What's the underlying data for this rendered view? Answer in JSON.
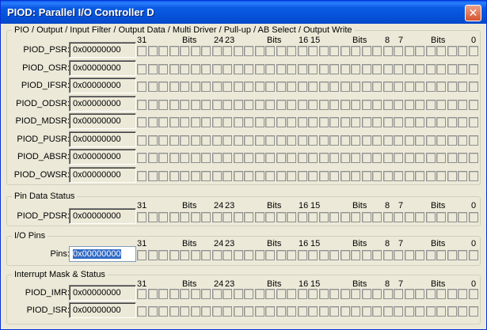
{
  "window": {
    "title": "PIOD: Parallel I/O Controller D",
    "close_glyph": "✕"
  },
  "groups": [
    {
      "title": "PIO / Output / Input Filter / Output Data / Multi Driver / Pull-up / AB Select / Output Write",
      "registers": [
        {
          "label": "PIOD_PSR:",
          "value": "0x00000000"
        },
        {
          "label": "PIOD_OSR:",
          "value": "0x00000000"
        },
        {
          "label": "PIOD_IFSR:",
          "value": "0x00000000"
        },
        {
          "label": "PIOD_ODSR:",
          "value": "0x00000000"
        },
        {
          "label": "PIOD_MDSR:",
          "value": "0x00000000"
        },
        {
          "label": "PIOD_PUSR:",
          "value": "0x00000000"
        },
        {
          "label": "PIOD_ABSR:",
          "value": "0x00000000"
        },
        {
          "label": "PIOD_OWSR:",
          "value": "0x00000000"
        }
      ]
    },
    {
      "title": "Pin Data Status",
      "registers": [
        {
          "label": "PIOD_PDSR:",
          "value": "0x00000000"
        }
      ]
    },
    {
      "title": "I/O Pins",
      "registers": [
        {
          "label": "Pins:",
          "value": "0x00000000"
        }
      ]
    },
    {
      "title": "Interrupt Mask & Status",
      "registers": [
        {
          "label": "PIOD_IMR:",
          "value": "0x00000000"
        },
        {
          "label": "PIOD_ISR:",
          "value": "0x00000000"
        }
      ]
    }
  ],
  "bit_header": {
    "n31": "31",
    "n24": "24",
    "n23": "23",
    "n16": "16",
    "n15": "15",
    "n8": "8",
    "n7": "7",
    "n0": "0",
    "bits_label": "Bits"
  }
}
